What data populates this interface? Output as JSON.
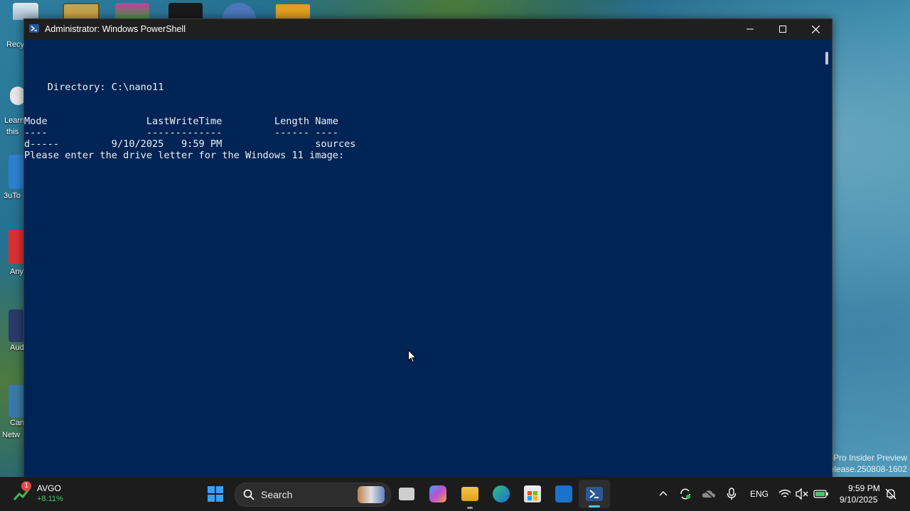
{
  "window": {
    "title": "Administrator: Windows PowerShell"
  },
  "console": {
    "directory_line": "    Directory: C:\\nano11",
    "header_line": "Mode                 LastWriteTime         Length Name",
    "separator_line": "----                 -------------         ------ ----",
    "row_line": "d-----         9/10/2025   9:59 PM                sources",
    "prompt_line": "Please enter the drive letter for the Windows 11 image:"
  },
  "desktop": {
    "labels": [
      "Recy",
      "Learn",
      "this",
      "3uTo",
      "Any",
      "Aud",
      "Can",
      "Netw"
    ],
    "watermark_line1": "Pro Insider Preview",
    "watermark_line2": "elease.250808-1602"
  },
  "taskbar": {
    "stock_ticker": "AVGO",
    "stock_change": "+8.11%",
    "stock_badge": "1",
    "search_label": "Search",
    "language": "ENG",
    "time": "9:59 PM",
    "date": "9/10/2025"
  },
  "colors": {
    "console_bg": "#012456",
    "titlebar_bg": "#1f1f1f",
    "taskbar_bg": "#1c1c1c"
  }
}
